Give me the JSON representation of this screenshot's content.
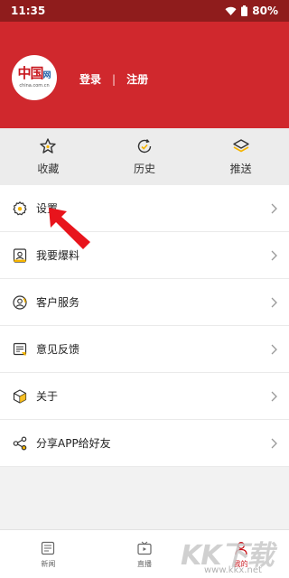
{
  "status": {
    "time": "11:35",
    "battery": "80%"
  },
  "header": {
    "logo_text": "中国",
    "logo_suffix": "网",
    "logo_url": "china.com.cn",
    "login": "登录",
    "separator": "|",
    "register": "注册"
  },
  "quick": [
    {
      "label": "收藏",
      "icon": "star-icon"
    },
    {
      "label": "历史",
      "icon": "history-icon"
    },
    {
      "label": "推送",
      "icon": "layers-icon"
    }
  ],
  "menu": [
    {
      "label": "设置",
      "icon": "gear-icon"
    },
    {
      "label": "我要爆料",
      "icon": "report-icon"
    },
    {
      "label": "客户服务",
      "icon": "service-icon"
    },
    {
      "label": "意见反馈",
      "icon": "feedback-icon"
    },
    {
      "label": "关于",
      "icon": "box-icon"
    },
    {
      "label": "分享APP给好友",
      "icon": "share-icon"
    }
  ],
  "tabbar": [
    {
      "label": "新闻",
      "icon": "news-icon"
    },
    {
      "label": "直播",
      "icon": "tv-icon"
    },
    {
      "label": "我的",
      "icon": "user-icon",
      "active": true
    }
  ],
  "watermark": {
    "big": "KK下载",
    "small": "www.kkx.net"
  },
  "colors": {
    "brand_red": "#d0282d",
    "status_bar": "#8f1c1c",
    "accent_yellow": "#f5b400"
  }
}
